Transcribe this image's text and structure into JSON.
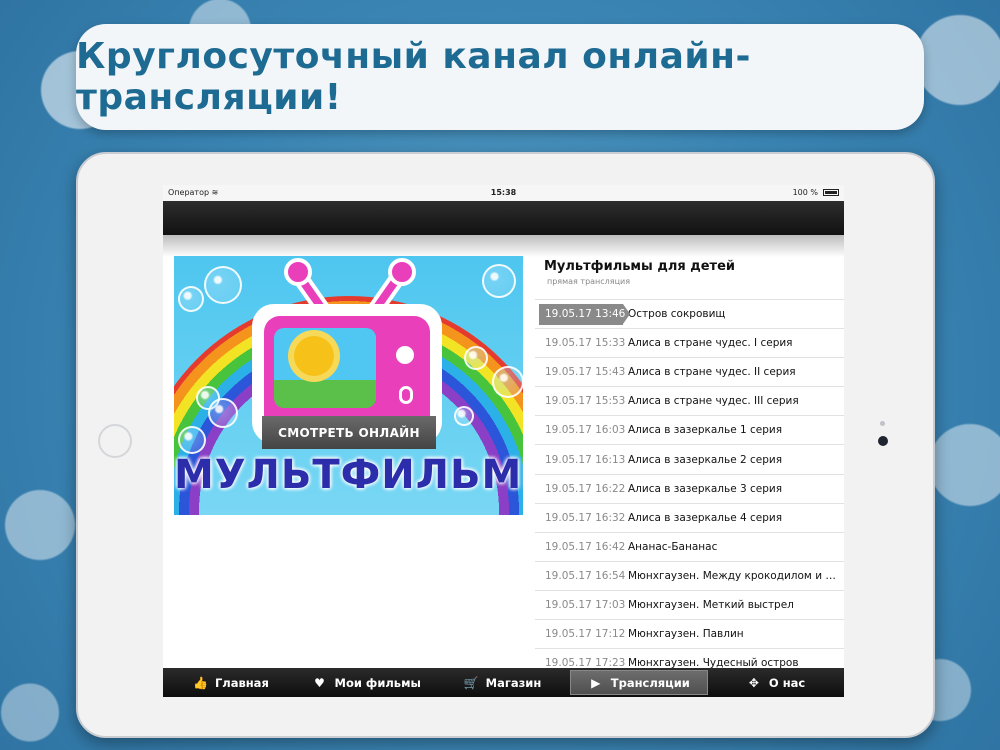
{
  "headline": "Круглосуточный канал онлайн-трансляции!",
  "status_bar": {
    "operator": "Оператор",
    "time": "15:38",
    "battery": "100 %"
  },
  "poster": {
    "watch_button": "СМОТРЕТЬ ОНЛАЙН",
    "title": "МУЛЬТФИЛЬМЫ"
  },
  "channel": {
    "title": "Мультфильмы для детей",
    "subtitle": "прямая трансляция"
  },
  "schedule": [
    {
      "datetime": "19.05.17 13:46",
      "name": "Остров сокровищ",
      "active": true
    },
    {
      "datetime": "19.05.17 15:33",
      "name": "Алиса в стране чудес. I серия"
    },
    {
      "datetime": "19.05.17 15:43",
      "name": "Алиса в стране чудес. II серия"
    },
    {
      "datetime": "19.05.17 15:53",
      "name": "Алиса в стране чудес. III серия"
    },
    {
      "datetime": "19.05.17 16:03",
      "name": "Алиса в зазеркалье 1 серия"
    },
    {
      "datetime": "19.05.17 16:13",
      "name": "Алиса в зазеркалье 2 серия"
    },
    {
      "datetime": "19.05.17 16:22",
      "name": "Алиса в зазеркалье 3 серия"
    },
    {
      "datetime": "19.05.17 16:32",
      "name": "Алиса в зазеркалье 4 серия"
    },
    {
      "datetime": "19.05.17 16:42",
      "name": "Ананас-Бананас"
    },
    {
      "datetime": "19.05.17 16:54",
      "name": "Мюнхгаузен. Между крокодилом и л..."
    },
    {
      "datetime": "19.05.17 17:03",
      "name": "Мюнхгаузен. Меткий выстрел"
    },
    {
      "datetime": "19.05.17 17:12",
      "name": "Мюнхгаузен. Павлин"
    },
    {
      "datetime": "19.05.17 17:23",
      "name": "Мюнхгаузен. Чудесный остров"
    }
  ],
  "tabs": [
    {
      "label": "Главная",
      "icon": "thumbs-up-icon",
      "glyph": "👍"
    },
    {
      "label": "Мои фильмы",
      "icon": "heart-icon",
      "glyph": "♥"
    },
    {
      "label": "Магазин",
      "icon": "cart-icon",
      "glyph": "🛒"
    },
    {
      "label": "Трансляции",
      "icon": "play-circle-icon",
      "glyph": "▶",
      "selected": true
    },
    {
      "label": "О нас",
      "icon": "expand-icon",
      "glyph": "✥"
    }
  ]
}
